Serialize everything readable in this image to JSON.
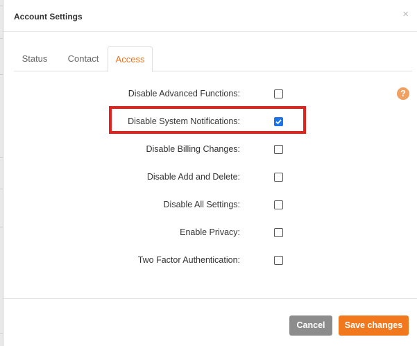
{
  "dialog": {
    "title": "Account Settings",
    "close_label": "×"
  },
  "tabs": [
    {
      "label": "Status",
      "active": false
    },
    {
      "label": "Contact",
      "active": false
    },
    {
      "label": "Access",
      "active": true
    }
  ],
  "settings": [
    {
      "label": "Disable Advanced Functions:",
      "checked": false
    },
    {
      "label": "Disable System Notifications:",
      "checked": true,
      "highlighted": true
    },
    {
      "label": "Disable Billing Changes:",
      "checked": false
    },
    {
      "label": "Disable Add and Delete:",
      "checked": false
    },
    {
      "label": "Disable All Settings:",
      "checked": false
    },
    {
      "label": "Enable Privacy:",
      "checked": false
    },
    {
      "label": "Two Factor Authentication:",
      "checked": false
    }
  ],
  "help": {
    "glyph": "?",
    "icon": "help-circle-icon"
  },
  "footer": {
    "cancel_label": "Cancel",
    "save_label": "Save changes"
  },
  "colors": {
    "accent": "#f2781e",
    "active_tab_text": "#e8731f",
    "checkbox_checked": "#1a73e8",
    "highlight_border": "#e5211b",
    "cancel_button": "#8c8c8c"
  }
}
